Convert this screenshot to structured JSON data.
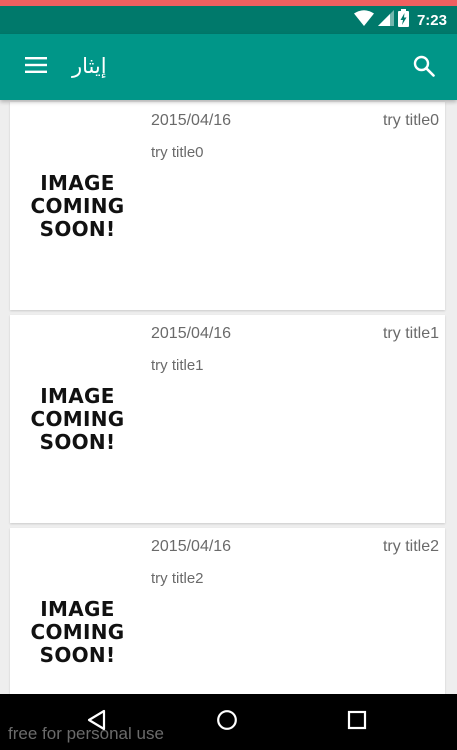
{
  "status_bar": {
    "time": "7:23",
    "icons": [
      "wifi-icon",
      "signal-icon",
      "battery-charging-icon"
    ]
  },
  "app_bar": {
    "title": "إيثار",
    "menu_icon": "menu-icon",
    "search_icon": "search-icon"
  },
  "list": {
    "items": [
      {
        "image_text": "IMAGE COMING SOON!",
        "date": "2015/04/16",
        "title": "try title0",
        "description": "try title0"
      },
      {
        "image_text": "IMAGE COMING SOON!",
        "date": "2015/04/16",
        "title": "try title1",
        "description": "try title1"
      },
      {
        "image_text": "IMAGE COMING SOON!",
        "date": "2015/04/16",
        "title": "try title2",
        "description": "try title2"
      }
    ]
  },
  "nav_bar": {
    "icons": [
      "back-icon",
      "home-icon",
      "recents-icon"
    ]
  },
  "watermark": "free for personal use",
  "colors": {
    "primary": "#009688",
    "primary_dark": "#00796b",
    "background": "#eeeeee",
    "card": "#ffffff",
    "text_secondary": "#6a6a6a"
  }
}
